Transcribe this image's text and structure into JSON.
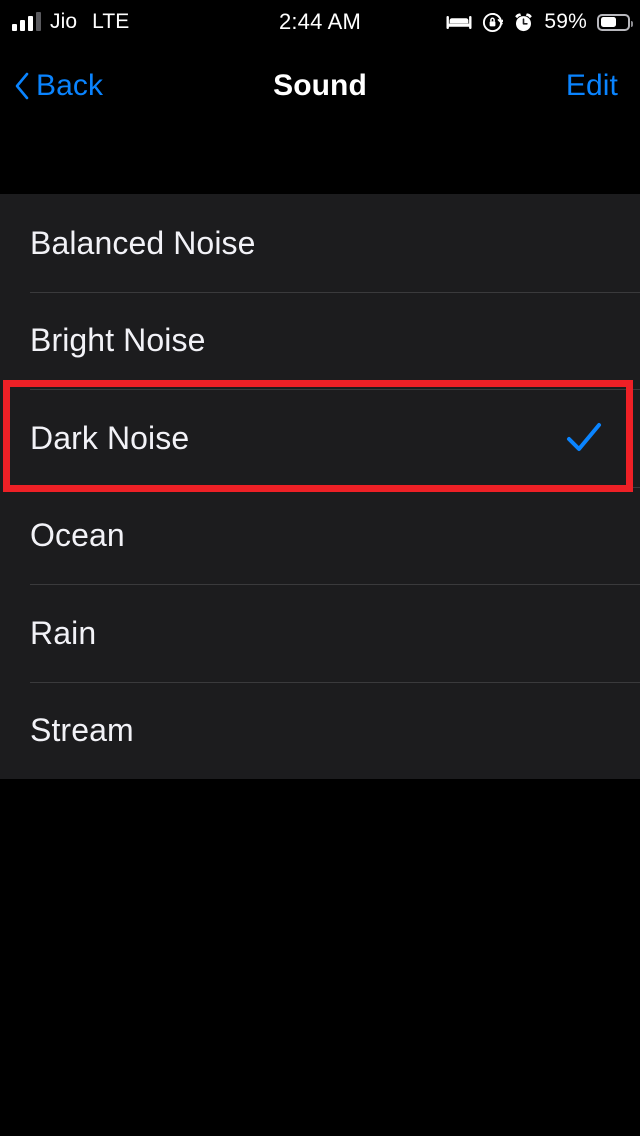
{
  "status_bar": {
    "carrier": "Jio",
    "network": "LTE",
    "time": "2:44 AM",
    "battery_percent": "59%",
    "battery_level": 59,
    "signal_bars_filled": 3,
    "signal_bars_total": 4,
    "icons": [
      "bed-icon",
      "rotation-lock-icon",
      "alarm-clock-icon",
      "battery-icon"
    ]
  },
  "nav_bar": {
    "back_label": "Back",
    "title": "Sound",
    "edit_label": "Edit",
    "back_icon": "chevron-left-icon",
    "tint_color": "#0a84ff"
  },
  "list": {
    "rows": [
      {
        "label": "Balanced Noise",
        "selected": false
      },
      {
        "label": "Bright Noise",
        "selected": false
      },
      {
        "label": "Dark Noise",
        "selected": true
      },
      {
        "label": "Ocean",
        "selected": false
      },
      {
        "label": "Rain",
        "selected": false
      },
      {
        "label": "Stream",
        "selected": false
      }
    ],
    "check_icon": "checkmark-icon",
    "check_color": "#0a84ff",
    "row_background": "#1c1c1e",
    "separator_color": "#3a3a3c"
  },
  "annotation": {
    "target_label": "Dark Noise",
    "color": "#ee2026"
  }
}
